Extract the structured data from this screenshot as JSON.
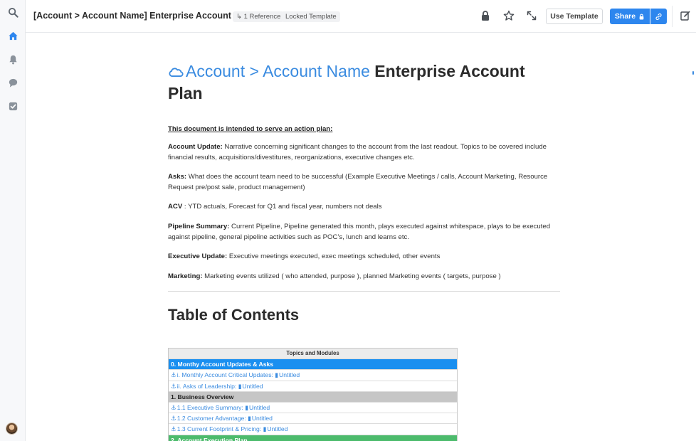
{
  "header": {
    "title": "[Account > Account Name] Enterprise Account Plan",
    "reference": "1 Reference",
    "locked": "Locked Template",
    "use_template": "Use Template",
    "share": "Share"
  },
  "rail": {
    "items": [
      "search-icon",
      "home-icon",
      "bell-icon",
      "chat-icon",
      "checkbox-icon"
    ],
    "accent": "#2d86ee"
  },
  "doc": {
    "title_account": "Account",
    "title_sep": " > ",
    "title_name": "Account Name",
    "title_rest": " Enterprise Account Plan",
    "intro": "This document is intended to serve an action plan:",
    "paragraphs": [
      {
        "label": "Account Update:",
        "text": " Narrative concerning significant changes to the account from the last readout. Topics to be covered include financial results, acquisitions/divestitures, reorganizations, executive changes etc."
      },
      {
        "label": "Asks:",
        "text": " What does the account team need to be successful (Example Executive Meetings / calls, Account Marketing, Resource Request pre/post sale, product management)"
      },
      {
        "label": "ACV",
        "text": " : YTD actuals, Forecast for Q1 and fiscal year, numbers not deals"
      },
      {
        "label": "Pipeline Summary:",
        "text": " Current Pipeline, Pipeline generated this month, plays executed against whitespace, plays to be executed against pipeline, general pipeline activities such as POC’s, lunch and learns etc."
      },
      {
        "label": "Executive Update:",
        "text": " Executive meetings executed, exec meetings scheduled, other events"
      },
      {
        "label": "Marketing:",
        "text": " Marketing events utilized ( who attended, purpose ), planned Marketing events ( targets, purpose )"
      }
    ],
    "toc_heading": "Table of Contents"
  },
  "toc": {
    "header": "Topics and Modules",
    "rows": [
      {
        "type": "section",
        "color": "#1a8ff0",
        "text": "0. Monthy Account Updates & Asks"
      },
      {
        "type": "link",
        "text": "i. Monthly Account Critical Updates:",
        "page": "Untitled"
      },
      {
        "type": "link",
        "text": "ii. Asks of Leadership:",
        "page": "Untitled"
      },
      {
        "type": "section",
        "color": "#c6c6c6",
        "text": "1. Business Overview"
      },
      {
        "type": "link",
        "text": "1.1 Executive Summary:",
        "page": "Untitled"
      },
      {
        "type": "link",
        "text": "1.2 Customer Advantage:",
        "page": "Untitled"
      },
      {
        "type": "link",
        "text": "1.3 Current Footprint & Pricing:",
        "page": "Untitled"
      },
      {
        "type": "section",
        "color": "#4cbb6c",
        "text": "2. Account Execution Plan"
      }
    ]
  }
}
